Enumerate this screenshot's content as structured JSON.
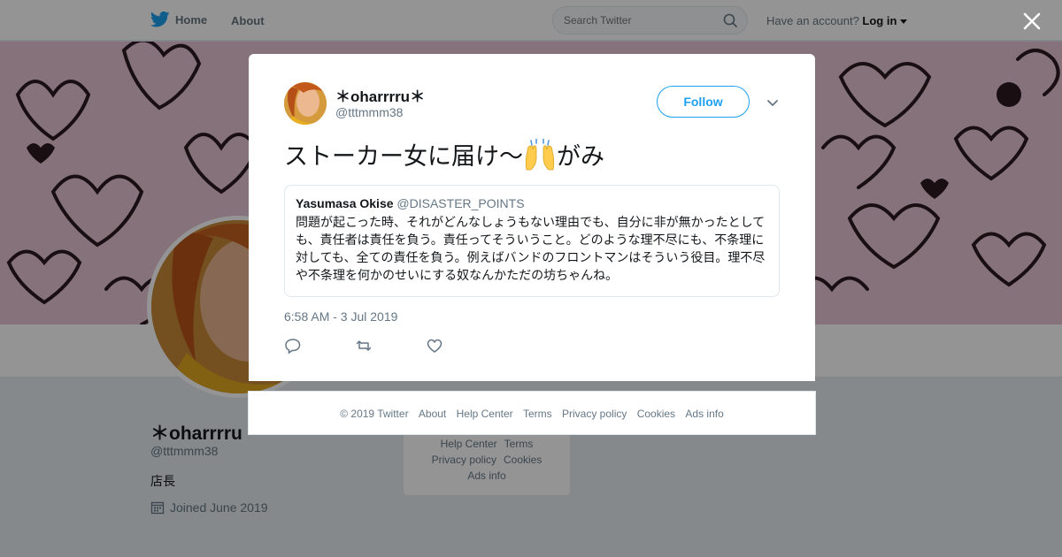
{
  "nav": {
    "home_label": "Home",
    "about_label": "About",
    "search_placeholder": "Search Twitter",
    "account_prompt": "Have an account?",
    "login_label": "Log in"
  },
  "profile": {
    "name": "＊oharrrru",
    "handle": "@tttmmm38",
    "bio": "店長",
    "joined": "Joined June 2019"
  },
  "bg_footer": {
    "help_center": "Help Center",
    "terms": "Terms",
    "privacy": "Privacy policy",
    "cookies": "Cookies",
    "ads_info": "Ads info"
  },
  "tweet": {
    "author_name": "＊oharrrru＊",
    "author_handle": "@tttmmm38",
    "follow_label": "Follow",
    "text_before": "ストーカー女に届け〜",
    "emoji": "raising-hands-emoji",
    "text_after": "がみ",
    "timestamp": "6:58 AM - 3 Jul 2019",
    "quote": {
      "name": "Yasumasa Okise",
      "handle": "@DISASTER_POINTS",
      "text": "問題が起こった時、それがどんなしょうもない理由でも、自分に非が無かったとしても、責任者は責任を負う。責任ってそういうこと。どのような理不尽にも、不条理に対しても、全ての責任を負う。例えばバンドのフロントマンはそういう役目。理不尽や不条理を何かのせいにする奴なんかただの坊ちゃんね。"
    }
  },
  "footer": {
    "copyright": "© 2019 Twitter",
    "about": "About",
    "help_center": "Help Center",
    "terms": "Terms",
    "privacy": "Privacy policy",
    "cookies": "Cookies",
    "ads_info": "Ads info"
  },
  "colors": {
    "brand": "#1da1f2",
    "secondary_text": "#657786",
    "banner_pink": "#e7c5d2"
  }
}
